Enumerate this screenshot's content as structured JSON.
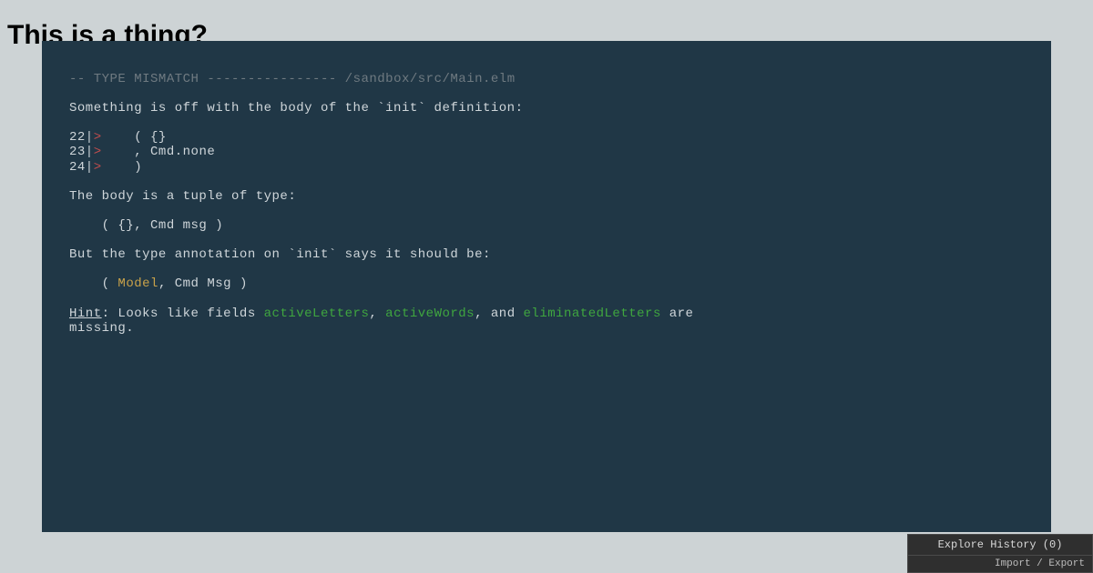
{
  "title": "This is a thing?",
  "error": {
    "header_label": "TYPE MISMATCH",
    "header_dashes_left": "-- ",
    "header_dashes_mid": " ---------------- ",
    "file": "/sandbox/src/Main.elm",
    "intro": "Something is off with the body of the `init` definition:",
    "code": [
      {
        "prefix": "22|",
        "marker": ">",
        "body": "    ( {}"
      },
      {
        "prefix": "23|",
        "marker": ">",
        "body": "    , Cmd.none"
      },
      {
        "prefix": "24|",
        "marker": ">",
        "body": "    )"
      }
    ],
    "body_is": "The body is a tuple of type:",
    "actual_type": "    ( {}, Cmd msg )",
    "but": "But the type annotation on `init` says it should be:",
    "expected_prefix": "    ( ",
    "expected_model": "Model",
    "expected_suffix": ", Cmd Msg )",
    "hint_label": "Hint",
    "hint_mid1": ": Looks like fields ",
    "field1": "activeLetters",
    "sep1": ", ",
    "field2": "activeWords",
    "sep2": ", and ",
    "field3": "eliminatedLetters",
    "hint_tail": " are\nmissing."
  },
  "debugger": {
    "explore": "Explore History (0)",
    "import_export": "Import / Export"
  }
}
